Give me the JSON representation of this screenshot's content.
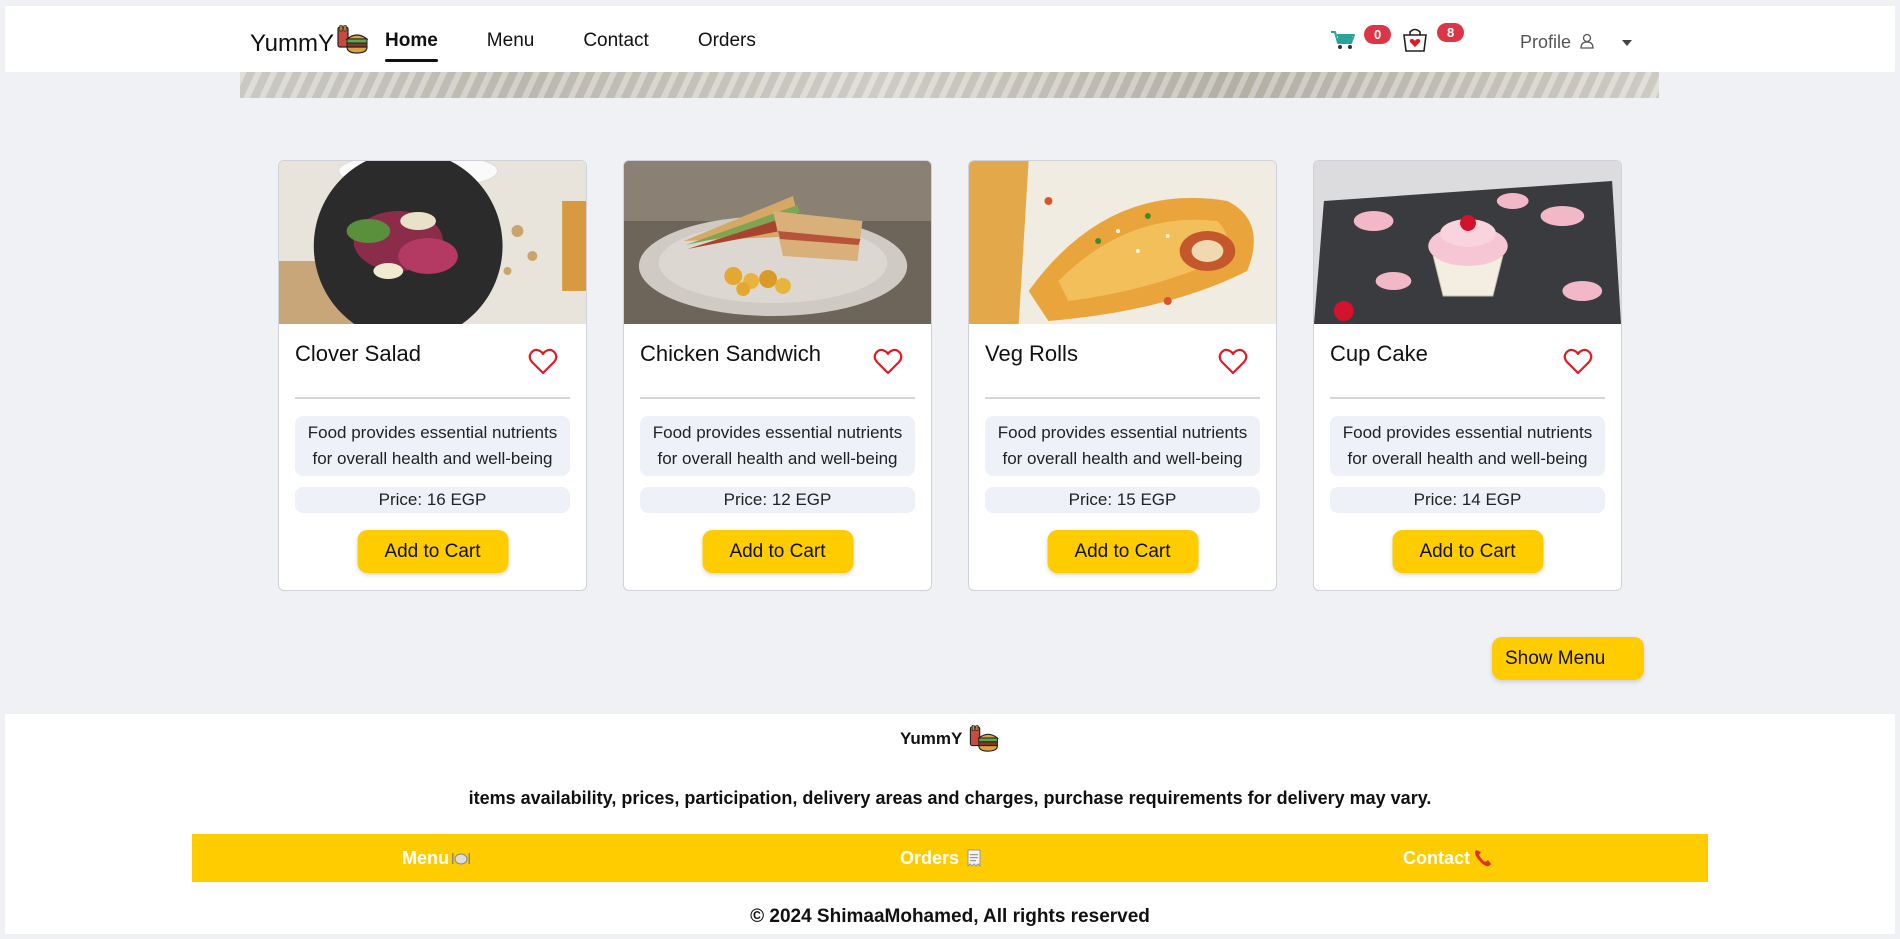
{
  "nav": {
    "brand": "YummY",
    "links": [
      "Home",
      "Menu",
      "Contact",
      "Orders"
    ],
    "active": "Home",
    "cart_count": "0",
    "bag_count": "8",
    "profile_label": "Profile"
  },
  "products": [
    {
      "name": "Clover Salad",
      "description": "Food provides essential nutrients for overall health and well-being",
      "price": "Price: 16 EGP",
      "button": "Add to Cart"
    },
    {
      "name": "Chicken Sandwich",
      "description": "Food provides essential nutrients for overall health and well-being",
      "price": "Price: 12 EGP",
      "button": "Add to Cart"
    },
    {
      "name": "Veg Rolls",
      "description": "Food provides essential nutrients for overall health and well-being",
      "price": "Price: 15 EGP",
      "button": "Add to Cart"
    },
    {
      "name": "Cup Cake",
      "description": "Food provides essential nutrients for overall health and well-being",
      "price": "Price: 14 EGP",
      "button": "Add to Cart"
    }
  ],
  "show_menu_label": "Show Menu",
  "footer": {
    "brand": "YummY",
    "disclaimer": "items availability, prices, participation, delivery areas and charges, purchase requirements for delivery may vary.",
    "links": [
      "Menu",
      "Orders",
      "Contact"
    ],
    "copyright": "© 2024 ShimaaMohamed, All rights reserved"
  },
  "colors": {
    "accent": "#ffcc00",
    "badge": "#dc3545",
    "heart": "#e01b24",
    "page_bg": "#f0f1f5"
  }
}
